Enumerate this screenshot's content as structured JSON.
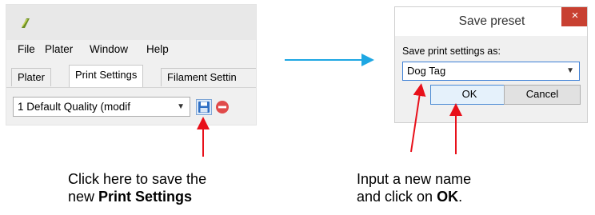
{
  "left_window": {
    "menu": [
      "File",
      "Plater",
      "Window",
      "Help"
    ],
    "tabs": [
      "Plater",
      "Print Settings",
      "Filament Settin"
    ],
    "active_tab": "Print Settings",
    "preset_value": "1 Default Quality (modif",
    "save_icon": "floppy-disk-icon",
    "delete_icon": "minus-circle-icon"
  },
  "dialog": {
    "title": "Save preset",
    "close_glyph": "×",
    "label": "Save print settings as:",
    "input_value": "Dog Tag",
    "ok_label": "OK",
    "cancel_label": "Cancel"
  },
  "captions": {
    "left_line1": "Click here to save the",
    "left_line2_prefix": "new ",
    "left_line2_bold": "Print Settings",
    "right_line1": "Input a new name",
    "right_line2_prefix": "and click on ",
    "right_line2_bold": "OK",
    "right_line2_suffix": "."
  },
  "colors": {
    "arrow_red": "#e8101a",
    "arrow_blue": "#1ea7e3",
    "close_red": "#c84031"
  }
}
